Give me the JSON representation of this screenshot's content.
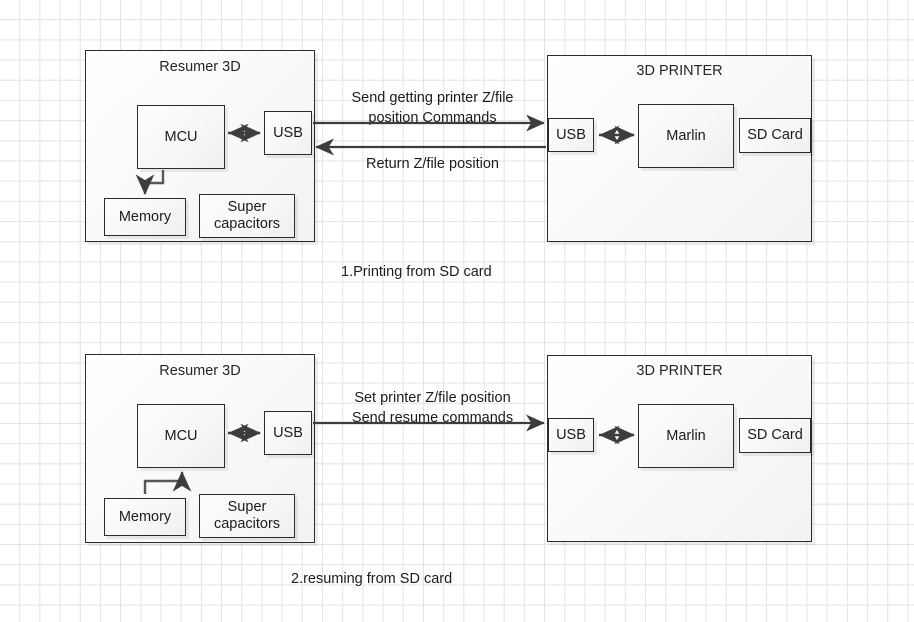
{
  "diagram": {
    "title_top": "Resumer 3D",
    "title_printer": "3D PRINTER",
    "colors": {
      "grid": "#e3e3e3",
      "stroke": "#2b2b2b",
      "arrow": "#3d3d3d",
      "text": "#1c1c1c",
      "box_fill": "#fafafa",
      "page_bg": "#ffffff"
    }
  },
  "section1": {
    "caption": "1.Printing from SD card",
    "resumer": {
      "title": "Resumer 3D",
      "blocks": {
        "mcu": "MCU",
        "usb": "USB",
        "memory": "Memory",
        "supercaps": "Super\ncapacitors"
      }
    },
    "printer": {
      "title": "3D PRINTER",
      "blocks": {
        "usb": "USB",
        "marlin": "Marlin",
        "sdcard": "SD Card"
      }
    },
    "links": {
      "forward": "Send getting printer Z/file\nposition Commands",
      "return": "Return Z/file position"
    }
  },
  "section2": {
    "caption": "2.resuming from SD card",
    "resumer": {
      "title": "Resumer 3D",
      "blocks": {
        "mcu": "MCU",
        "usb": "USB",
        "memory": "Memory",
        "supercaps": "Super\ncapacitors"
      }
    },
    "printer": {
      "title": "3D PRINTER",
      "blocks": {
        "usb": "USB",
        "marlin": "Marlin",
        "sdcard": "SD Card"
      }
    },
    "links": {
      "forward": "Set printer Z/file position\nSend resume commands"
    }
  }
}
